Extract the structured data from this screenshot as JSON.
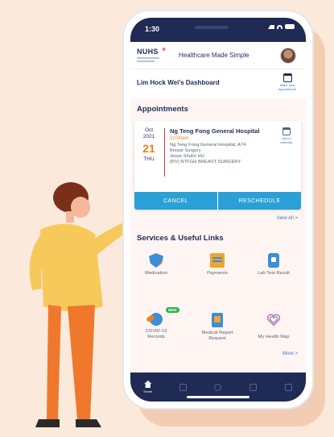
{
  "status_bar": {
    "time": "1:30"
  },
  "header": {
    "logo": "NUHS",
    "tagline": "Healthcare Made Simple"
  },
  "dashboard": {
    "title": "Lim Hock Wei's Dashboard",
    "make_appointment": "Make new appointment"
  },
  "appointments": {
    "section_title": "Appointments",
    "card": {
      "month": "Oct",
      "year": "2021",
      "day": "21",
      "weekday": "THU",
      "hospital": "Ng Teng Fong General Hospital",
      "time": "10:00am",
      "location": "Ng Teng Fong General Hospital, A74",
      "department": "Breast Surgery",
      "doctor": "Jesse Shulin HU",
      "clinic": "(RV) NTFGH BREAST SURGERY",
      "add_to_calendar": "Add to calendar",
      "cancel_label": "CANCEL",
      "reschedule_label": "RESCHEDULE"
    },
    "view_all": "View All  >"
  },
  "services": {
    "section_title": "Services & Useful Links",
    "items": [
      {
        "label": "Medication",
        "icon": "medication-icon"
      },
      {
        "label": "Payments",
        "icon": "payments-icon"
      },
      {
        "label": "Lab Test Result",
        "icon": "lab-test-icon"
      },
      {
        "label": "COVID-19 Records",
        "icon": "covid-icon"
      },
      {
        "label": "Medical Report Request",
        "icon": "medical-report-icon"
      },
      {
        "label": "My Health Map",
        "icon": "health-map-icon"
      }
    ],
    "new_badge": "NEW",
    "more": "More  >"
  },
  "tabbar": {
    "home_label": "Home"
  },
  "colors": {
    "navy": "#1f2a55",
    "accent_blue": "#2aa0d6",
    "orange": "#e6801c",
    "background": "#fbe9dc"
  }
}
